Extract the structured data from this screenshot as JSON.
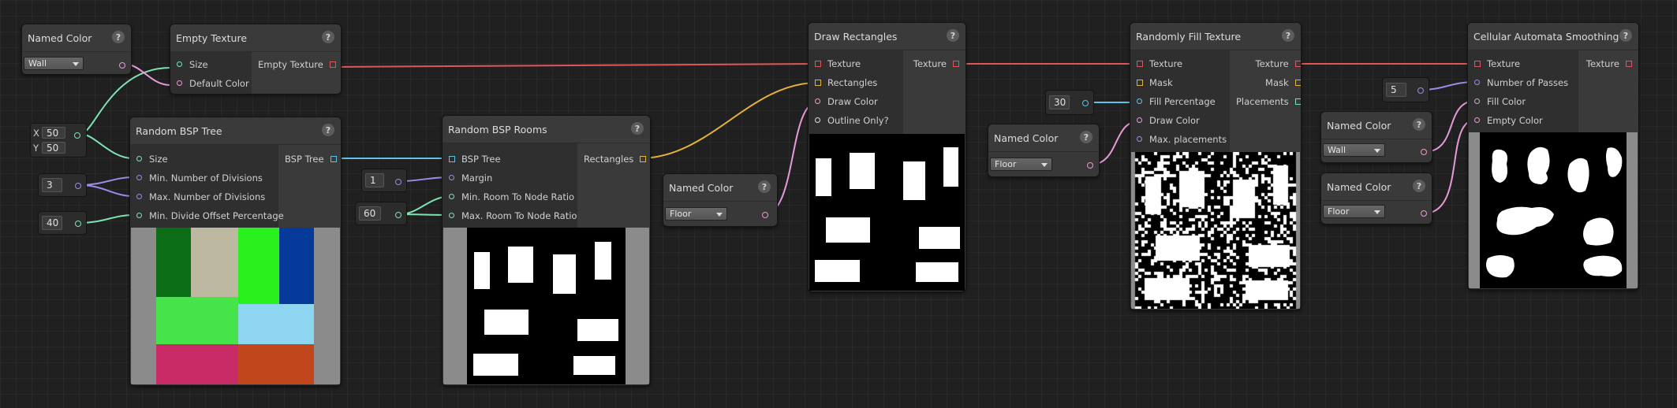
{
  "colors": {
    "texture_port": "#e05656",
    "rect_port": "#e5b33a",
    "color_port": "#e69bd6",
    "number_port": "#9a8ce8",
    "vector_port": "#7fe3b4",
    "bsp_port": "#5fc3e8",
    "bool_port": "#dddddd"
  },
  "nodes": {
    "named_color_1": {
      "title": "Named Color",
      "value": "Wall"
    },
    "empty_texture": {
      "title": "Empty Texture",
      "inputs": [
        "Size",
        "Default Color"
      ],
      "output": "Empty Texture"
    },
    "vector_field": {
      "x_label": "X",
      "x_value": "50",
      "y_label": "Y",
      "y_value": "50"
    },
    "random_bsp_tree": {
      "title": "Random BSP Tree",
      "inputs": [
        "Size",
        "Min. Number of Divisions",
        "Max. Number of Divisions",
        "Min. Divide Offset Percentage"
      ],
      "output": "BSP Tree"
    },
    "min_div_value": "3",
    "offset_value": "40",
    "random_bsp_rooms": {
      "title": "Random BSP Rooms",
      "inputs": [
        "BSP Tree",
        "Margin",
        "Min. Room To Node Ratio",
        "Max. Room To Node Ratio"
      ],
      "output": "Rectangles"
    },
    "margin_value": "1",
    "ratio_value": "60",
    "named_color_2": {
      "title": "Named Color",
      "value": "Floor"
    },
    "draw_rectangles": {
      "title": "Draw Rectangles",
      "inputs": [
        "Texture",
        "Rectangles",
        "Draw Color",
        "Outline Only?"
      ],
      "output": "Texture"
    },
    "fill_pct_value": "30",
    "named_color_3": {
      "title": "Named Color",
      "value": "Floor"
    },
    "randomly_fill": {
      "title": "Randomly Fill Texture",
      "inputs": [
        "Texture",
        "Mask",
        "Fill Percentage",
        "Draw Color",
        "Max. placements"
      ],
      "outputs": [
        "Texture",
        "Mask",
        "Placements"
      ]
    },
    "passes_value": "5",
    "named_color_4": {
      "title": "Named Color",
      "value": "Wall"
    },
    "named_color_5": {
      "title": "Named Color",
      "value": "Floor"
    },
    "cellular": {
      "title": "Cellular Automata Smoothing",
      "inputs": [
        "Texture",
        "Number of Passes",
        "Fill Color",
        "Empty Color"
      ],
      "output": "Texture"
    }
  },
  "help_icon": "?"
}
